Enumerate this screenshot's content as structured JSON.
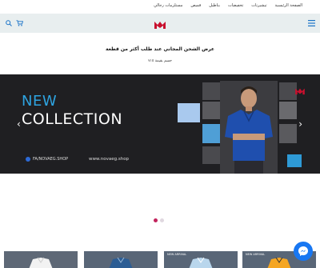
{
  "nav": {
    "links": [
      "الصفحة الرئيسية",
      "تيشيرتات",
      "تخفيضات",
      "بناطيل",
      "قميص",
      "مستلزمات رجالي"
    ]
  },
  "header": {
    "icons": [
      "menu-icon",
      "logo",
      "cart-icon",
      "search-icon"
    ],
    "brand_color": "#c8102e"
  },
  "promo": {
    "text": "عرض الشحن المجاني عند طلب أكثر من قطعة",
    "subtext": "جسم بقيمة ٧١٥"
  },
  "banner": {
    "title_new": "NEW",
    "title_collection": "COLLECTION",
    "facebook": "FA/NOVAEG.SHOP",
    "website": "www.novaeg.shop",
    "colors": {
      "background": "#1f1f22",
      "accent": "#2ea3e0"
    }
  },
  "carousel": {
    "slide_count": 2,
    "active_index": 0
  },
  "products": {
    "badges": [
      "",
      "",
      "NEW ARRIVAL",
      "NEW ARRIVAL"
    ]
  },
  "messenger": {
    "icon": "messenger-icon"
  }
}
